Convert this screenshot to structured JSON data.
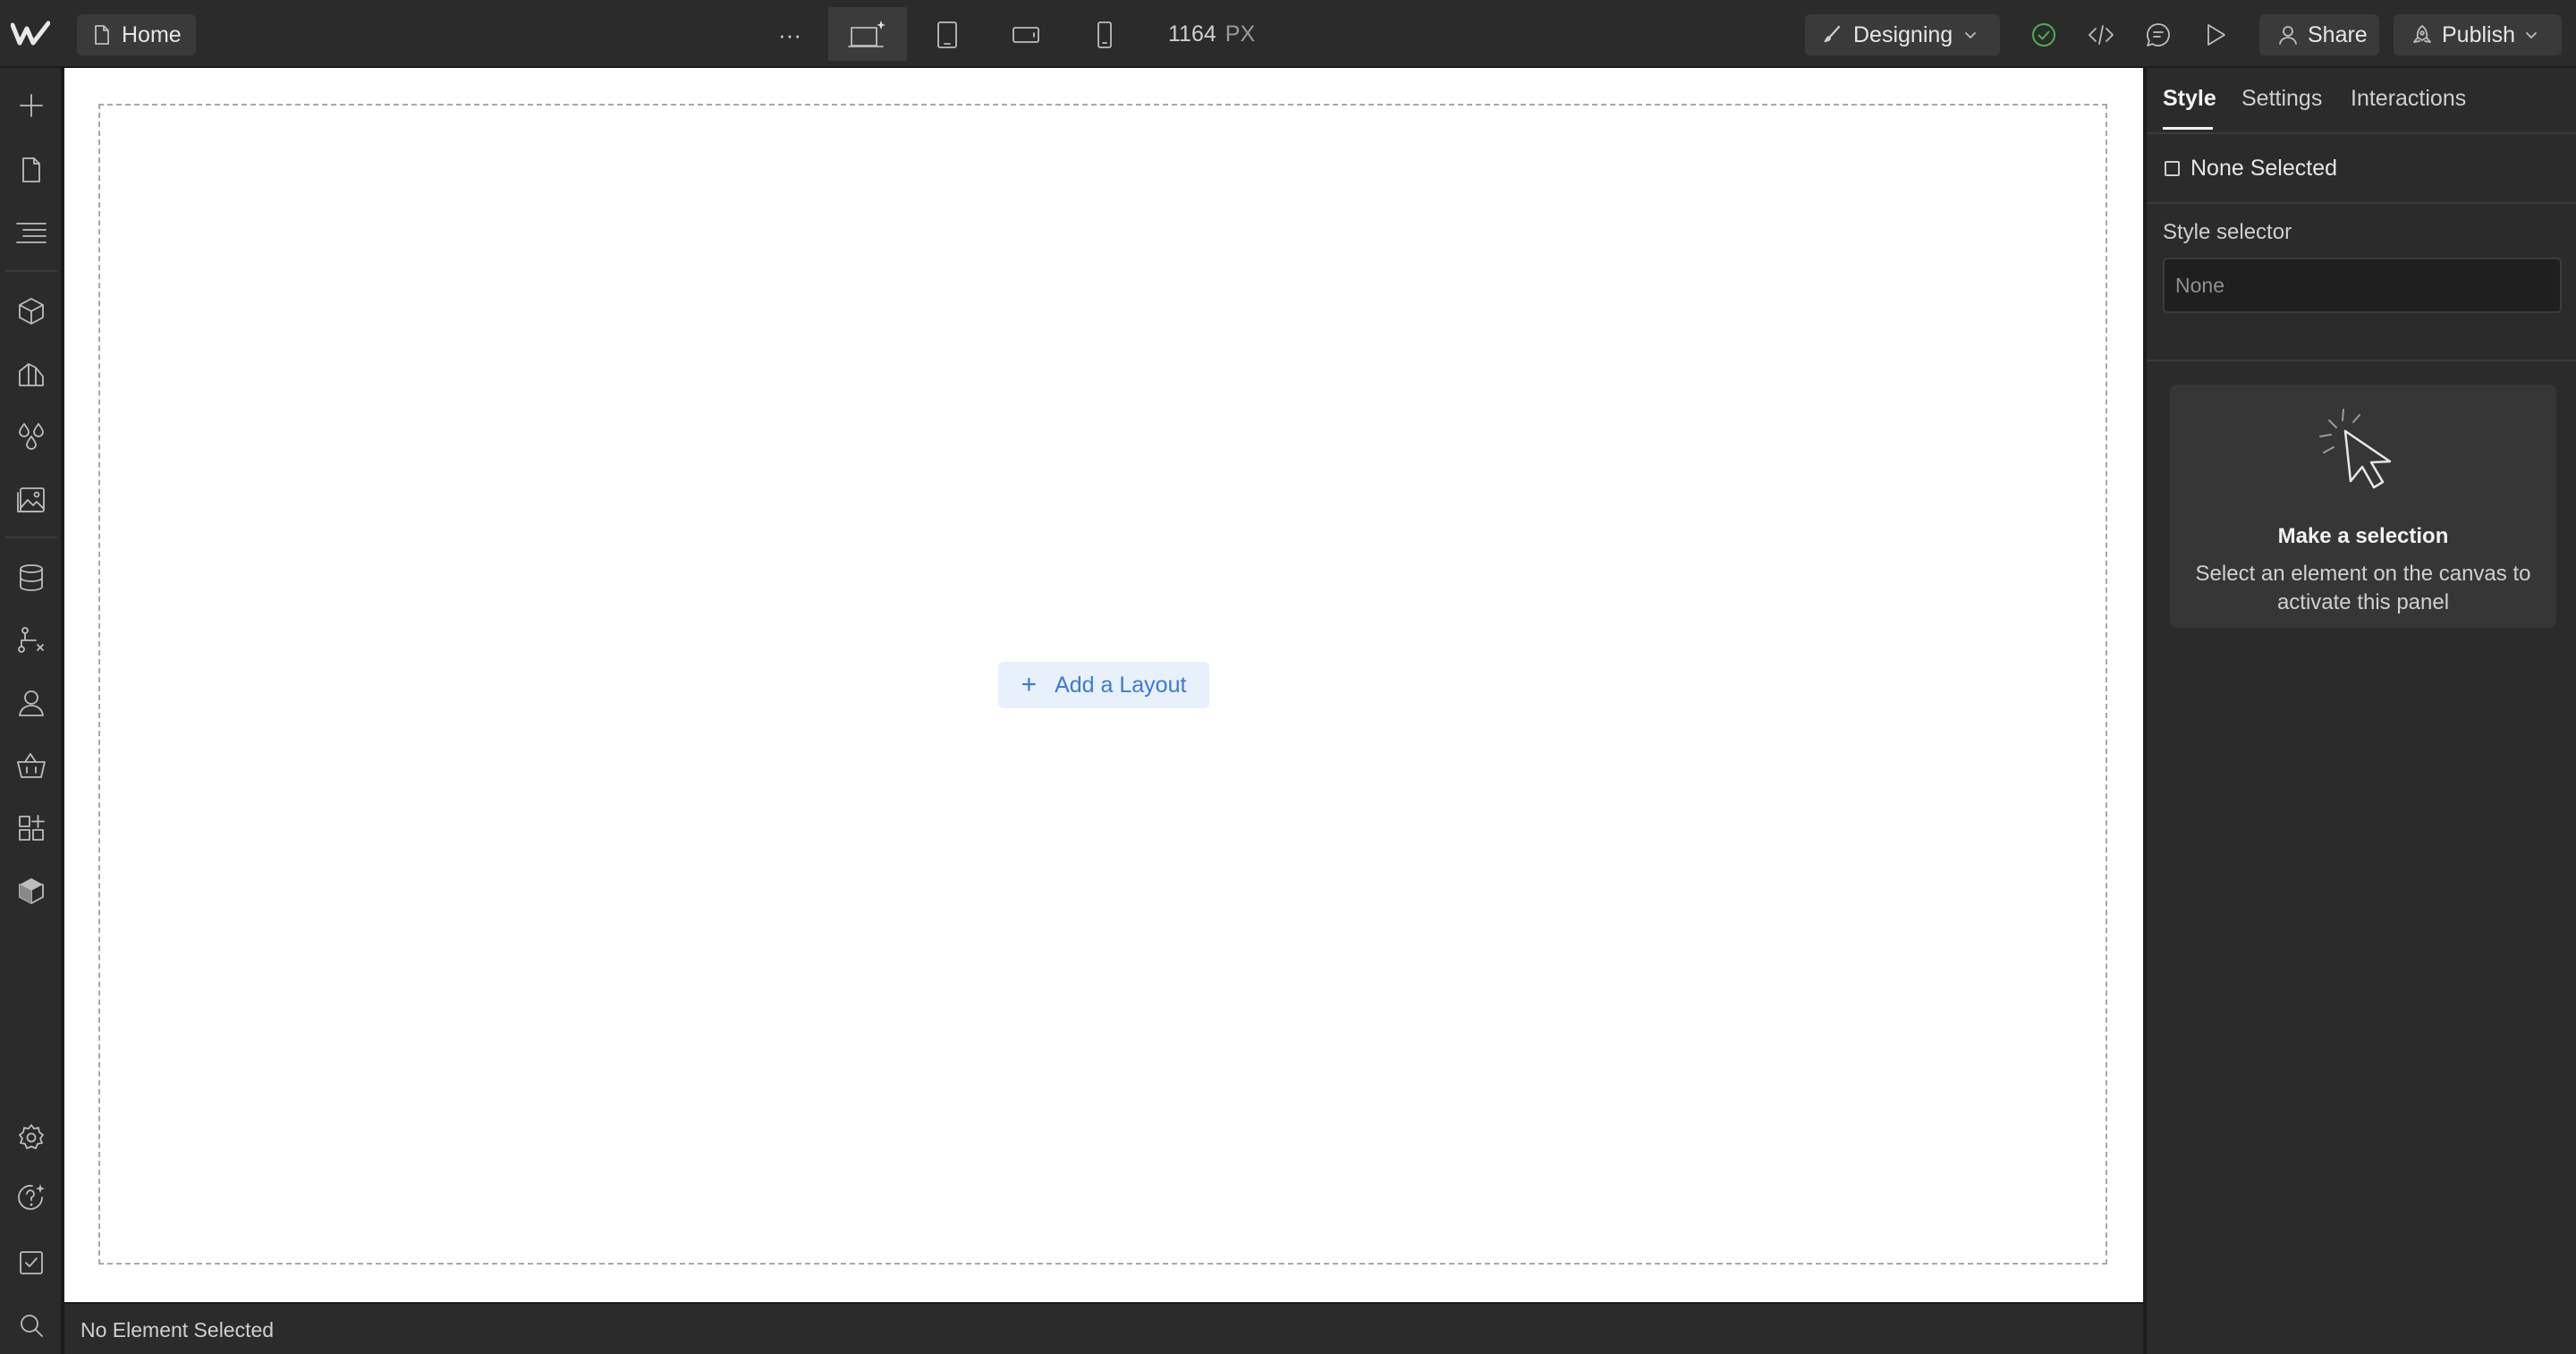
{
  "topbar": {
    "page_name": "Home",
    "width_value": "1164",
    "width_unit": "PX",
    "mode_label": "Designing",
    "share_label": "Share",
    "publish_label": "Publish",
    "more_label": "···"
  },
  "canvas": {
    "add_layout_label": "Add a Layout"
  },
  "statusbar": {
    "text": "No Element Selected"
  },
  "rightpanel": {
    "tabs": [
      {
        "label": "Style",
        "active": true
      },
      {
        "label": "Settings",
        "active": false
      },
      {
        "label": "Interactions",
        "active": false
      }
    ],
    "selection_label": "None Selected",
    "style_selector_label": "Style selector",
    "style_selector_placeholder": "None",
    "empty_title": "Make a selection",
    "empty_text": "Select an element on the canvas to activate this panel"
  },
  "leftbar": {
    "icons": [
      "add-icon",
      "pages-icon",
      "navigator-icon",
      "components-icon",
      "style-manager-icon",
      "variables-icon",
      "assets-icon",
      "cms-icon",
      "logic-icon",
      "users-icon",
      "ecommerce-icon",
      "apps-icon",
      "libraries-icon",
      "settings-icon",
      "help-icon",
      "audit-icon",
      "search-icon",
      "video-icon"
    ]
  },
  "colors": {
    "chrome": "#2b2b2b",
    "canvas": "#ffffff",
    "accent_blue": "#3a7ad5",
    "status_green": "#4caf50"
  }
}
